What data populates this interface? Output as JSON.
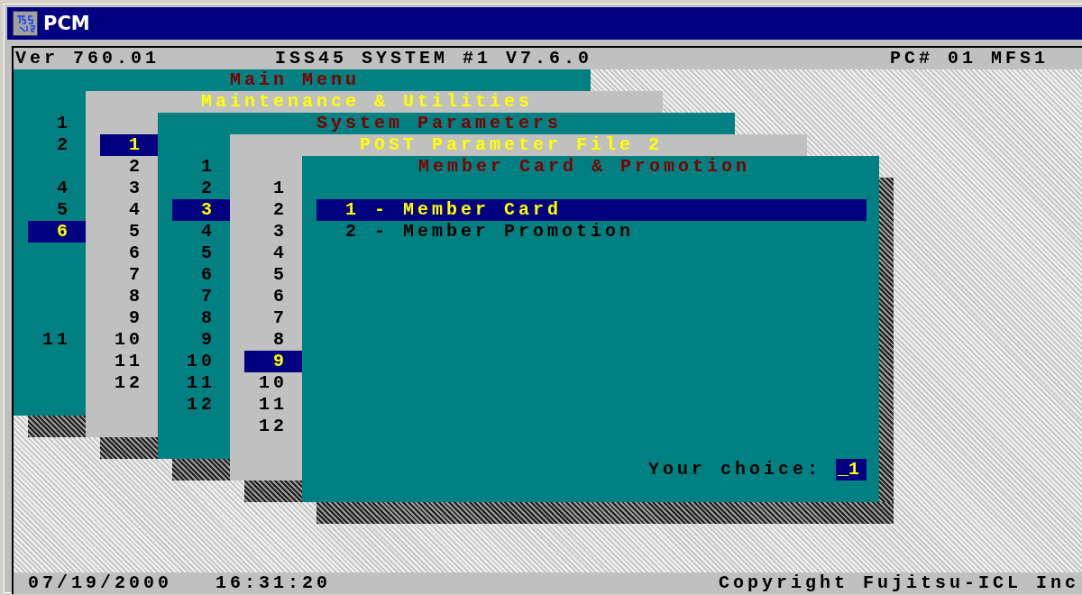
{
  "window": {
    "title": "PCM"
  },
  "header": {
    "version": "Ver 760.01",
    "system": "ISS45 SYSTEM #1 V7.6.0",
    "station": "PC# 01 MFS1"
  },
  "windows": [
    {
      "kind": "numbered",
      "title": "Main Menu",
      "items": [
        {
          "label": "1",
          "selected": false
        },
        {
          "label": "2",
          "selected": false
        },
        {
          "label": "4",
          "selected": false
        },
        {
          "label": "5",
          "selected": false
        },
        {
          "label": "6",
          "selected": true
        },
        {
          "label": "11",
          "selected": false
        }
      ]
    },
    {
      "kind": "numbered",
      "title": "Maintenance & Utilities",
      "items": [
        {
          "label": "1",
          "selected": true
        },
        {
          "label": "2",
          "selected": false
        },
        {
          "label": "3",
          "selected": false
        },
        {
          "label": "4",
          "selected": false
        },
        {
          "label": "5",
          "selected": false
        },
        {
          "label": "6",
          "selected": false
        },
        {
          "label": "7",
          "selected": false
        },
        {
          "label": "8",
          "selected": false
        },
        {
          "label": "9",
          "selected": false
        },
        {
          "label": "10",
          "selected": false
        },
        {
          "label": "11",
          "selected": false
        },
        {
          "label": "12",
          "selected": false
        }
      ]
    },
    {
      "kind": "numbered",
      "title": "System Parameters",
      "items": [
        {
          "label": "1",
          "selected": false
        },
        {
          "label": "2",
          "selected": false
        },
        {
          "label": "3",
          "selected": true
        },
        {
          "label": "4",
          "selected": false
        },
        {
          "label": "5",
          "selected": false
        },
        {
          "label": "6",
          "selected": false
        },
        {
          "label": "7",
          "selected": false
        },
        {
          "label": "8",
          "selected": false
        },
        {
          "label": "9",
          "selected": false
        },
        {
          "label": "10",
          "selected": false
        },
        {
          "label": "11",
          "selected": false
        },
        {
          "label": "12",
          "selected": false
        }
      ]
    },
    {
      "kind": "numbered",
      "title": "POST Parameter File 2",
      "items": [
        {
          "label": "1",
          "selected": false
        },
        {
          "label": "2",
          "selected": false
        },
        {
          "label": "3",
          "selected": false
        },
        {
          "label": "4",
          "selected": false
        },
        {
          "label": "5",
          "selected": false
        },
        {
          "label": "6",
          "selected": false
        },
        {
          "label": "7",
          "selected": false
        },
        {
          "label": "8",
          "selected": false
        },
        {
          "label": "9",
          "selected": true
        },
        {
          "label": "10",
          "selected": false
        },
        {
          "label": "11",
          "selected": false
        },
        {
          "label": "12",
          "selected": false
        }
      ]
    },
    {
      "kind": "options",
      "title": "Member Card & Promotion",
      "items": [
        {
          "label": "1 - Member Card",
          "selected": true
        },
        {
          "label": "2 - Member Promotion",
          "selected": false
        }
      ],
      "prompt": {
        "label": "Your choice:",
        "value": "_1"
      }
    }
  ],
  "status_bar": {
    "date": "07/19/2000",
    "time": "16:31:20",
    "copyright": "Copyright Fujitsu-ICL Inc"
  }
}
